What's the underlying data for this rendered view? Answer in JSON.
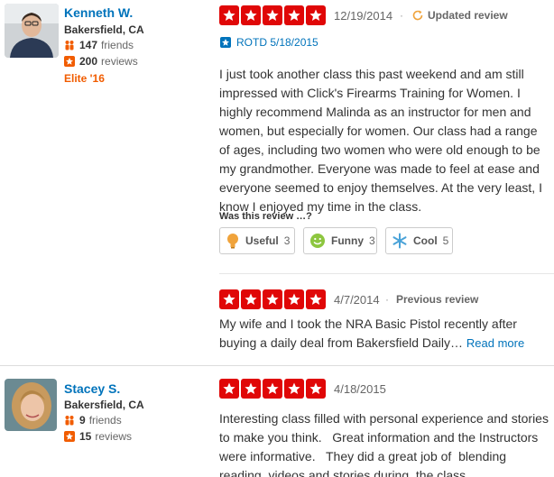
{
  "reviews": [
    {
      "user": {
        "name": "Kenneth W.",
        "location": "Bakersfield, CA",
        "friends_count": "147",
        "friends_label": "friends",
        "reviews_count": "200",
        "reviews_label": "reviews",
        "elite": "Elite '16"
      },
      "rating": 5,
      "date": "12/19/2014",
      "separator": "·",
      "status": "Updated review",
      "rotd": "ROTD 5/18/2015",
      "text": "I just took another class this past weekend and am still impressed with Click's Firearms Training for Women. I highly recommend Malinda as an instructor for men and women, but especially for women. Our class had a range of ages, including two women who were old enough to be my grandmother. Everyone was made to feel at ease and everyone seemed to enjoy themselves. At the very least, I know I enjoyed my time in the class.",
      "was_this": "Was this review …?",
      "votes": [
        {
          "label": "Useful",
          "count": "3"
        },
        {
          "label": "Funny",
          "count": "3"
        },
        {
          "label": "Cool",
          "count": "5"
        }
      ],
      "previous": {
        "rating": 5,
        "date": "4/7/2014",
        "separator": "·",
        "status": "Previous review",
        "text": "My wife and I took the NRA Basic Pistol recently after buying a daily deal from Bakersfield Daily…",
        "read_more": "Read more"
      }
    },
    {
      "user": {
        "name": "Stacey S.",
        "location": "Bakersfield, CA",
        "friends_count": "9",
        "friends_label": "friends",
        "reviews_count": "15",
        "reviews_label": "reviews"
      },
      "rating": 5,
      "date": "4/18/2015",
      "text": "Interesting class filled with personal experience and stories to make you think.   Great information and the Instructors were informative.   They did a great job of  blending reading, videos and stories during  the class."
    }
  ],
  "colors": {
    "star_red": "#e00707",
    "link_blue": "#0073bb",
    "elite_orange": "#f15c00"
  }
}
